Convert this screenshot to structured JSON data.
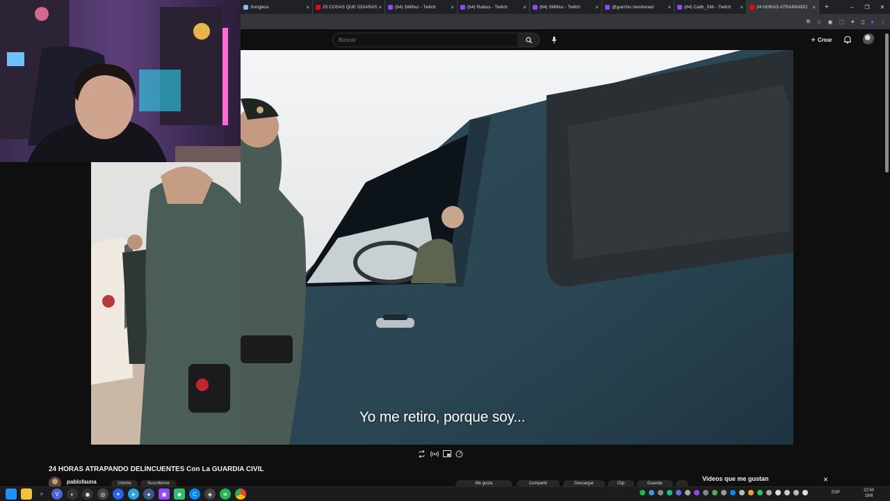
{
  "browser": {
    "tabs": [
      {
        "title": "Songless",
        "favicon": "page-icon",
        "color": "#8ab4f8"
      },
      {
        "title": "25 COSAS QUE ODIARÁS",
        "favicon": "youtube-icon",
        "color": "#ff0000"
      },
      {
        "title": "(64) Sillithur - Twitch",
        "favicon": "twitch-icon",
        "color": "#9146ff"
      },
      {
        "title": "(64) Rubius - Twitch",
        "favicon": "twitch-icon",
        "color": "#9146ff"
      },
      {
        "title": "(64) Sillithur - Twitch",
        "favicon": "twitch-icon",
        "color": "#9146ff"
      },
      {
        "title": "@guircho mentioned",
        "favicon": "twitch-icon",
        "color": "#9146ff"
      },
      {
        "title": "(64) Caith_Sith - Twitch",
        "favicon": "twitch-icon",
        "color": "#9146ff"
      },
      {
        "title": "24 HORAS ATRAPANDO",
        "favicon": "youtube-icon",
        "color": "#ff0000",
        "active": true
      }
    ]
  },
  "youtube": {
    "search_placeholder": "Buscar",
    "create_label": "Crear"
  },
  "video": {
    "subtitle": "Yo me retiro, porque soy...",
    "title": "24 HORAS ATRAPANDO DELINCUENTES Con La GUARDIA CIVIL",
    "channel": "pablofauna"
  },
  "chips": [
    {
      "label": "Unirme"
    },
    {
      "label": "Suscribirme"
    },
    {
      "label": "Me gusta"
    },
    {
      "label": "Compartir"
    },
    {
      "label": "Descargar"
    },
    {
      "label": "Clip"
    },
    {
      "label": "Guardar"
    }
  ],
  "liked_panel": {
    "title": "Videos que me gustan"
  },
  "taskbar": {
    "language": "ESP",
    "time": "22:50",
    "date": "19/8"
  },
  "colors": {
    "youtube_bg": "#0f0f0f",
    "chrome_tabstrip": "#202124",
    "accent": "#ff0000",
    "twitch": "#9146ff"
  }
}
